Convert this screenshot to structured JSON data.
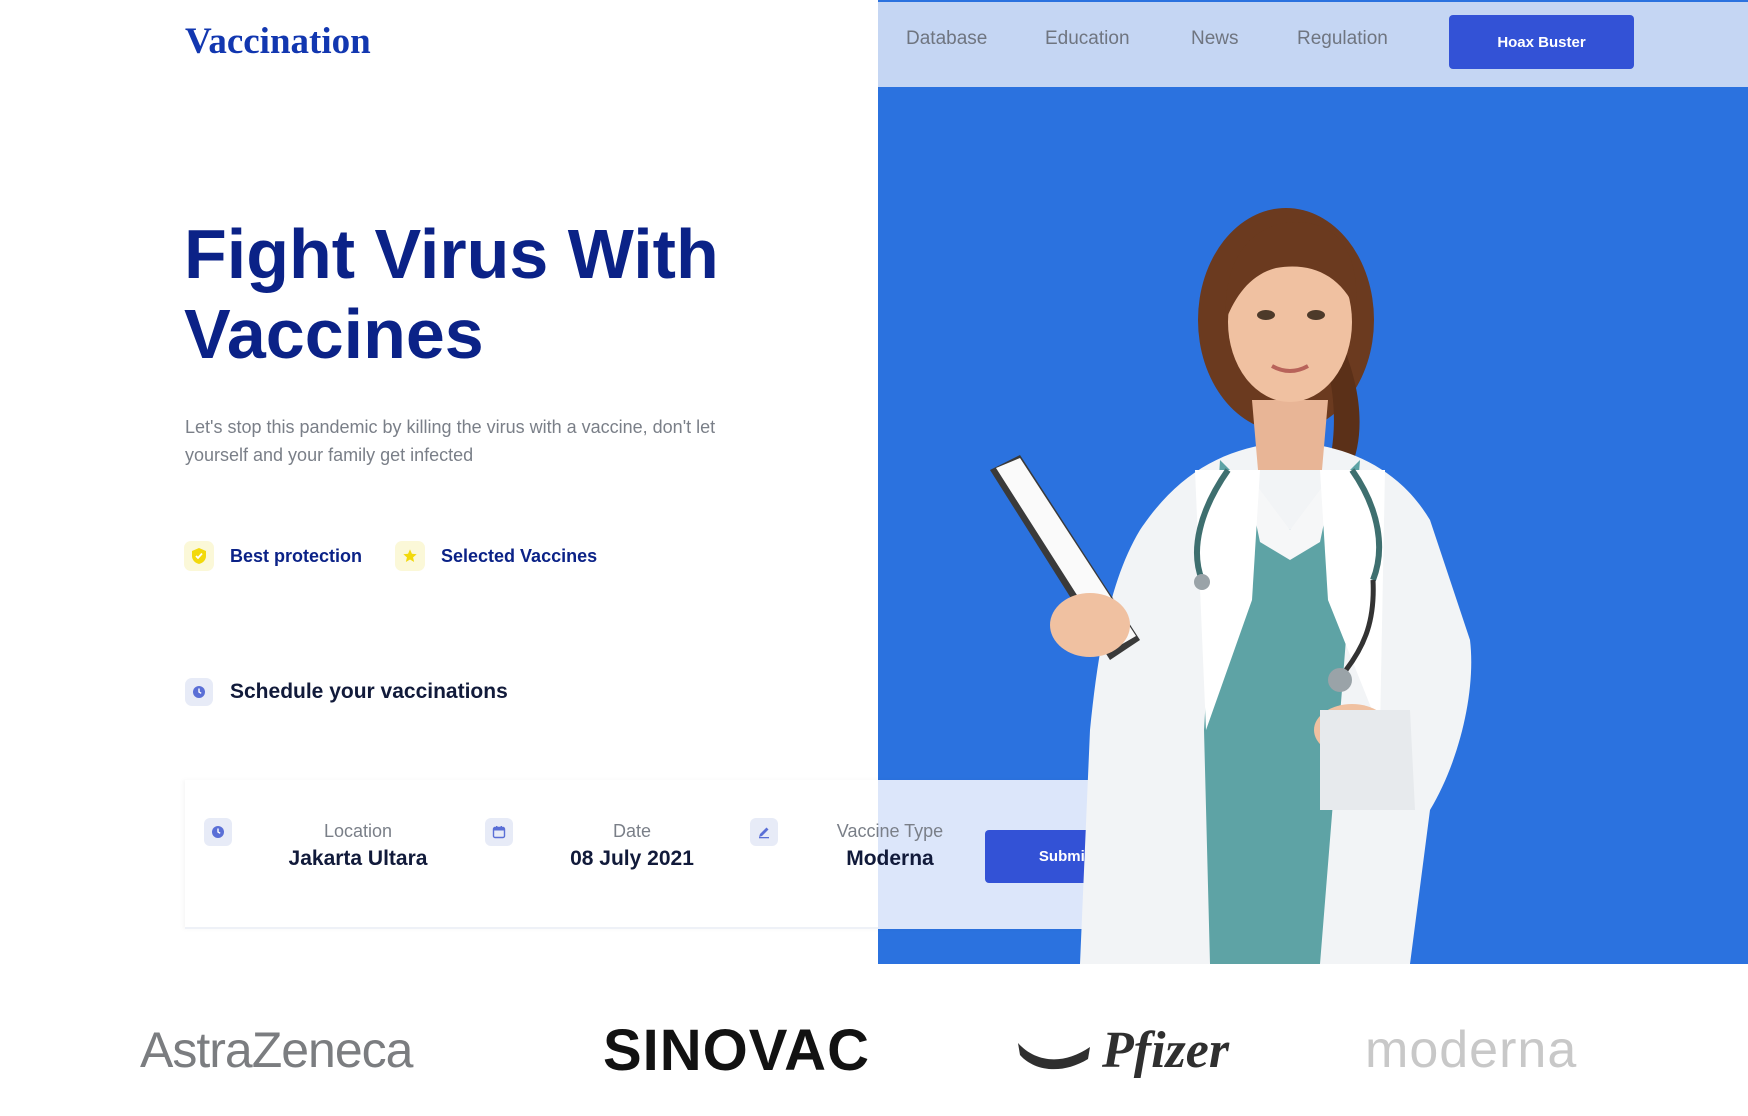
{
  "brand": {
    "logo": "Vaccination"
  },
  "nav": {
    "links": [
      "Database",
      "Education",
      "News",
      "Regulation"
    ],
    "cta": "Hoax Buster"
  },
  "hero": {
    "title_line1": "Fight Virus With",
    "title_line2": "Vaccines",
    "description": "Let's stop this pandemic by killing the virus with a vaccine, don't let yourself and your family get infected",
    "features": [
      "Best protection",
      "Selected Vaccines"
    ],
    "schedule_heading": "Schedule your vaccinations"
  },
  "form": {
    "location": {
      "label": "Location",
      "value": "Jakarta Ultara"
    },
    "date": {
      "label": "Date",
      "value": "08 July 2021"
    },
    "vaccine": {
      "label": "Vaccine Type",
      "value": "Moderna"
    },
    "submit": "Submite"
  },
  "partners": {
    "astrazeneca": "AstraZeneca",
    "sinovac": "SINOVAC",
    "pfizer": "Pfizer",
    "moderna": "moderna"
  },
  "colors": {
    "accent": "#3352d6",
    "hero_bg": "#2b72df",
    "nav_bg": "#c5d6f3",
    "title": "#0b2287"
  },
  "icons": {
    "feature_1": "shield-check-icon",
    "feature_2": "star-icon",
    "schedule": "clock-icon",
    "location": "clock-icon",
    "date": "calendar-icon",
    "vaccine": "pen-icon"
  }
}
